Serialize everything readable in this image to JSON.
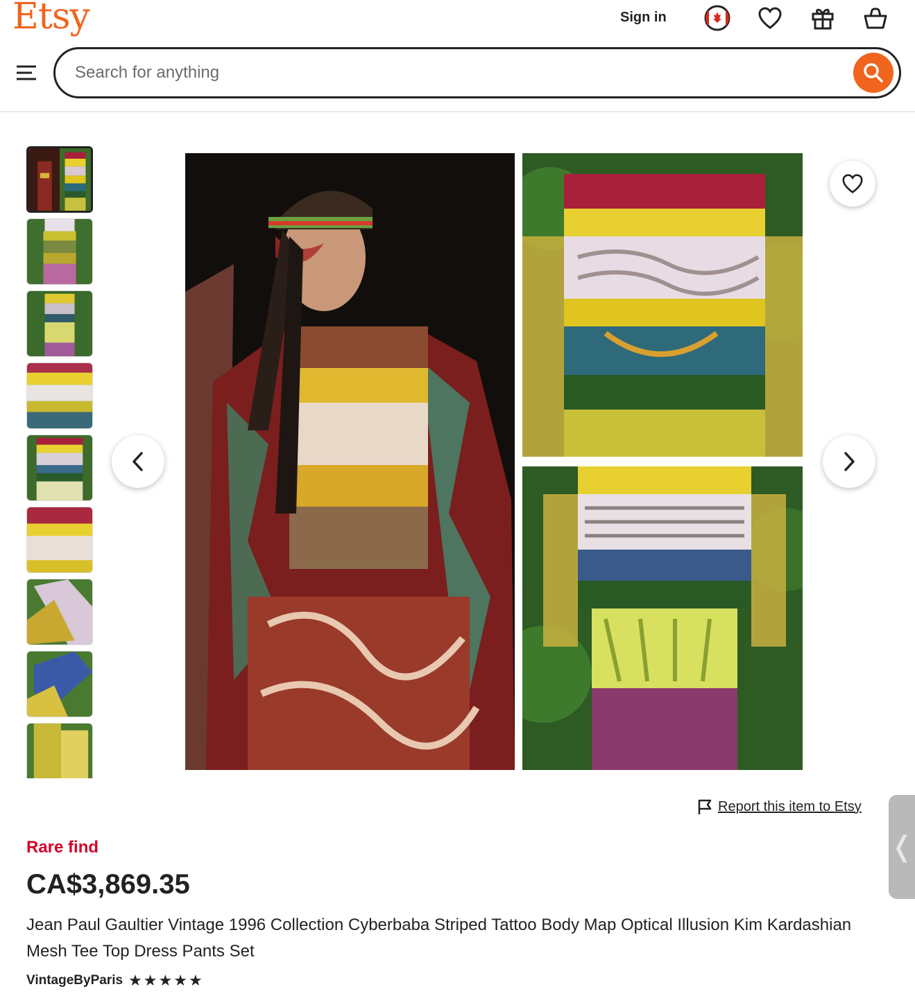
{
  "header": {
    "logo": "Etsy",
    "sign_in": "Sign in",
    "icons": [
      "canada-flag-icon",
      "heart-icon",
      "gift-icon",
      "basket-icon"
    ]
  },
  "search": {
    "placeholder": "Search for anything"
  },
  "gallery": {
    "thumbnail_count": 9,
    "active_index": 0
  },
  "actions": {
    "report_label": "Report this item to Etsy"
  },
  "listing": {
    "badge": "Rare find",
    "price": "CA$3,869.35",
    "title": "Jean Paul Gaultier Vintage 1996 Collection Cyberbaba Striped Tattoo Body Map Optical Illusion Kim Kardashian Mesh Tee Top Dress Pants Set",
    "shop_name": "VintageByParis",
    "rating_stars": "★★★★★"
  },
  "colors": {
    "brand": "#f1641e",
    "rare": "#d4002a"
  }
}
